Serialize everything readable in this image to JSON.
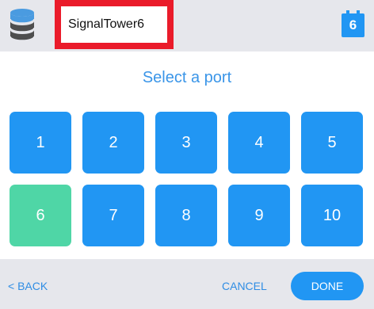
{
  "header": {
    "device_icon": "database-stack-icon",
    "device_name": "SignalTower6",
    "port_badge_icon": "port-connector-icon",
    "selected_port_label": "6"
  },
  "main": {
    "heading": "Select a port",
    "ports": [
      "1",
      "2",
      "3",
      "4",
      "5",
      "6",
      "7",
      "8",
      "9",
      "10"
    ],
    "selected_port": "6"
  },
  "footer": {
    "back_label": "< BACK",
    "cancel_label": "CANCEL",
    "done_label": "DONE"
  },
  "colors": {
    "accent": "#2196f3",
    "selected": "#4fd6a6",
    "highlight_frame": "#ea1b2a",
    "bar_background": "#e6e7ec"
  }
}
